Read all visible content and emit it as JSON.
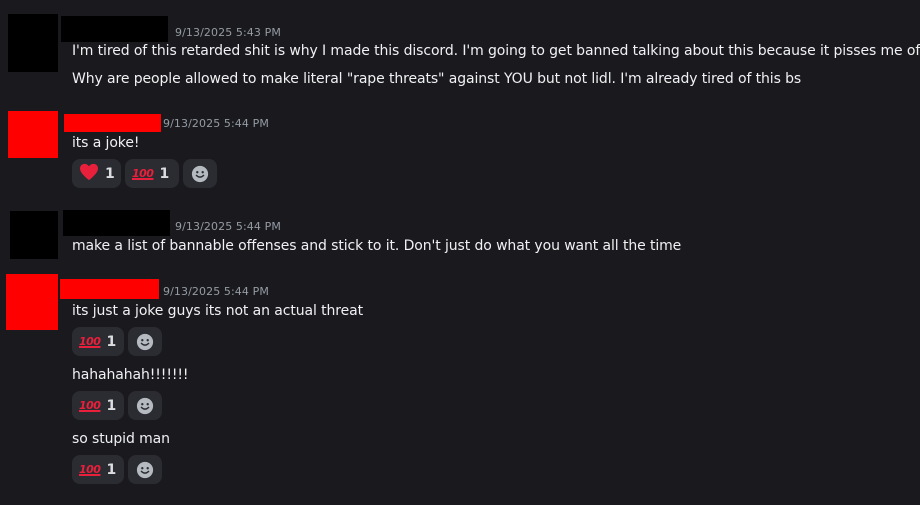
{
  "messages": [
    {
      "author_color": "#000000",
      "avatar_color": "#000000",
      "timestamp": "9/13/2025 5:43 PM",
      "lines": [
        "I'm tired of this retarded shit is why I made this discord. I'm going to get banned talking about this because it pisses me off",
        "Why are people allowed to make literal \"rape threats\" against YOU but not lidl. I'm already tired of this bs"
      ]
    },
    {
      "author_color": "#ff0000",
      "avatar_color": "#ff0000",
      "timestamp": "9/13/2025 5:44 PM",
      "lines": [
        "its a joke!"
      ],
      "reactions": [
        {
          "icon": "heart-icon",
          "count": "1"
        },
        {
          "icon": "hundred-points-icon",
          "count": "1"
        }
      ]
    },
    {
      "author_color": "#000000",
      "avatar_color": "#000000",
      "timestamp": "9/13/2025 5:44 PM",
      "lines": [
        "make a list of bannable offenses and stick to it. Don't just do what you want all the time"
      ]
    },
    {
      "author_color": "#ff0000",
      "avatar_color": "#ff0000",
      "timestamp": "9/13/2025 5:44 PM",
      "lines": [
        "its just a joke guys its not an actual threat"
      ],
      "reactions": [
        {
          "icon": "hundred-points-icon",
          "count": "1"
        }
      ]
    },
    {
      "lines": [
        "hahahahah!!!!!!!"
      ],
      "reactions": [
        {
          "icon": "hundred-points-icon",
          "count": "1"
        }
      ]
    },
    {
      "lines": [
        "so stupid man"
      ],
      "reactions": [
        {
          "icon": "hundred-points-icon",
          "count": "1"
        }
      ]
    }
  ],
  "emoji": {
    "hundred_text": "100"
  },
  "colors": {
    "background": "#1a1a1e",
    "reaction_bg": "#2b2c31",
    "heart": "#e8203c",
    "hundred": "#e8203c"
  }
}
